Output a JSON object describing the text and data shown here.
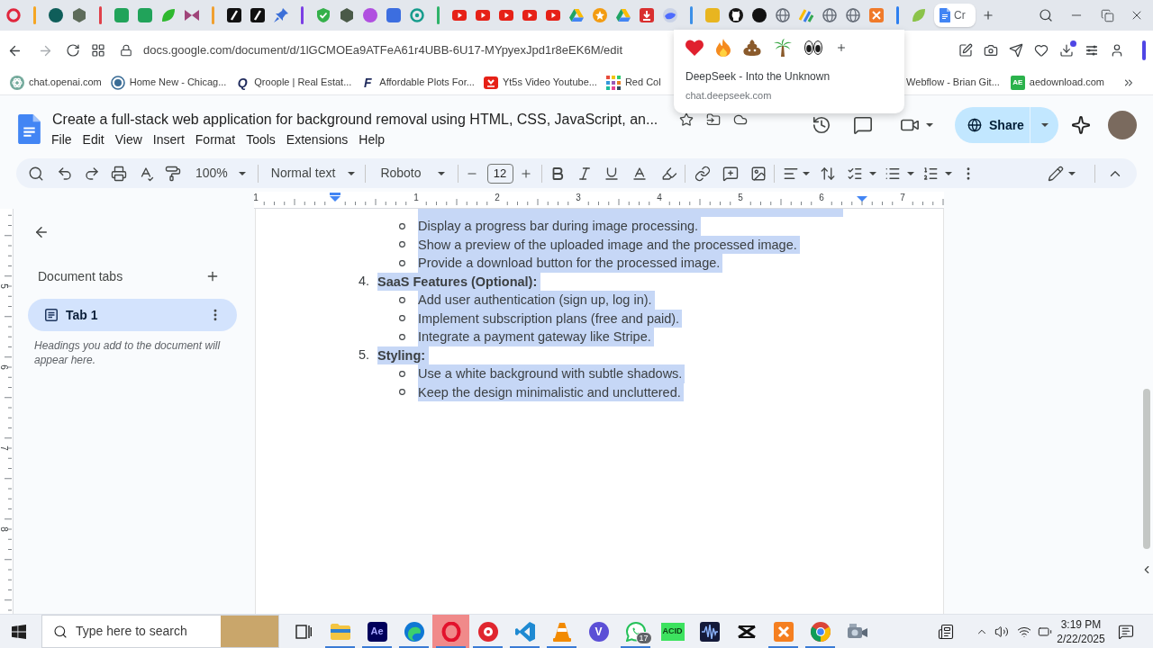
{
  "browser": {
    "active_tab": {
      "label": "Cr",
      "selected": true
    },
    "url": "docs.google.com/document/d/1lGCMOEa9ATFeA61r4UBB-6U17-MYpyexJpd1r8eEK6M/edit",
    "bookmarks": [
      {
        "kind": "knot",
        "label": "chat.openai.com"
      },
      {
        "kind": "ring",
        "label": "Home New - Chicag..."
      },
      {
        "kind": "glyph",
        "glyph": "Q",
        "label": "Qroople | Real Estat..."
      },
      {
        "kind": "glyph",
        "glyph": "F",
        "label": "Affordable Plots For..."
      },
      {
        "kind": "play",
        "label": "Yt5s Video Youtube..."
      },
      {
        "kind": "grid",
        "label": "Red Col"
      }
    ],
    "bookmarks_right": [
      {
        "kind": "covered",
        "label": "Webflow - Brian Git..."
      },
      {
        "kind": "tile",
        "glyph": "AE",
        "label": "aedownload.com"
      }
    ],
    "hover_card": {
      "title": "DeepSeek - Into the Unknown",
      "domain": "chat.deepseek.com"
    }
  },
  "docs": {
    "title": "Create a full-stack web application for background removal using HTML, CSS, JavaScript, an...",
    "menus": [
      "File",
      "Edit",
      "View",
      "Insert",
      "Format",
      "Tools",
      "Extensions",
      "Help"
    ],
    "share": "Share",
    "toolbar": {
      "zoom": "100%",
      "style": "Normal text",
      "font": "Roboto",
      "font_size": "12"
    },
    "ruler": [
      "1",
      "1",
      "2",
      "3",
      "4",
      "5",
      "6",
      "7"
    ],
    "side_ruler": [
      "5",
      "6",
      "7",
      "8"
    ],
    "sidebar": {
      "heading": "Document tabs",
      "tabs": [
        {
          "label": "Tab 1",
          "selected": true
        }
      ],
      "hint": "Headings you add to the document will appear here."
    },
    "content": {
      "selected": true,
      "sections": [
        {
          "bullets": [
            "Display a progress bar during image processing.",
            "Show a preview of the uploaded image and the processed image.",
            "Provide a download button for the processed image."
          ]
        },
        {
          "number": "4.",
          "heading": "SaaS Features (Optional):",
          "bullets": [
            "Add user authentication (sign up, log in).",
            "Implement subscription plans (free and paid).",
            "Integrate a payment gateway like Stripe."
          ]
        },
        {
          "number": "5.",
          "heading": "Styling:",
          "bullets": [
            "Use a white background with subtle shadows.",
            "Keep the design minimalistic and uncluttered."
          ]
        }
      ]
    }
  },
  "taskbar": {
    "search": {
      "placeholder": "Type here to search"
    },
    "apps": [
      {
        "kind": "taskview",
        "open": false,
        "active": false
      },
      {
        "kind": "folder",
        "open": true,
        "active": false
      },
      {
        "kind": "tile",
        "glyph": "Ae",
        "open": true,
        "active": false
      },
      {
        "kind": "edge",
        "open": true,
        "active": false
      },
      {
        "kind": "ring",
        "open": true,
        "active": true
      },
      {
        "kind": "disc",
        "open": true,
        "active": false
      },
      {
        "kind": "code",
        "open": true,
        "active": false
      },
      {
        "kind": "cone",
        "open": true,
        "active": false
      },
      {
        "kind": "letter",
        "glyph": "V",
        "open": false,
        "active": false
      },
      {
        "kind": "chat",
        "badge": "17",
        "open": true,
        "active": false
      },
      {
        "kind": "label",
        "glyph": "ACID",
        "open": false,
        "active": false
      },
      {
        "kind": "wave",
        "open": false,
        "active": false
      },
      {
        "kind": "knot",
        "open": false,
        "active": false
      },
      {
        "kind": "xtile",
        "open": true,
        "active": false
      },
      {
        "kind": "chrome",
        "open": true,
        "active": false
      },
      {
        "kind": "camera",
        "open": false,
        "active": false
      }
    ],
    "time": "3:19 PM",
    "date": "2/22/2025"
  }
}
